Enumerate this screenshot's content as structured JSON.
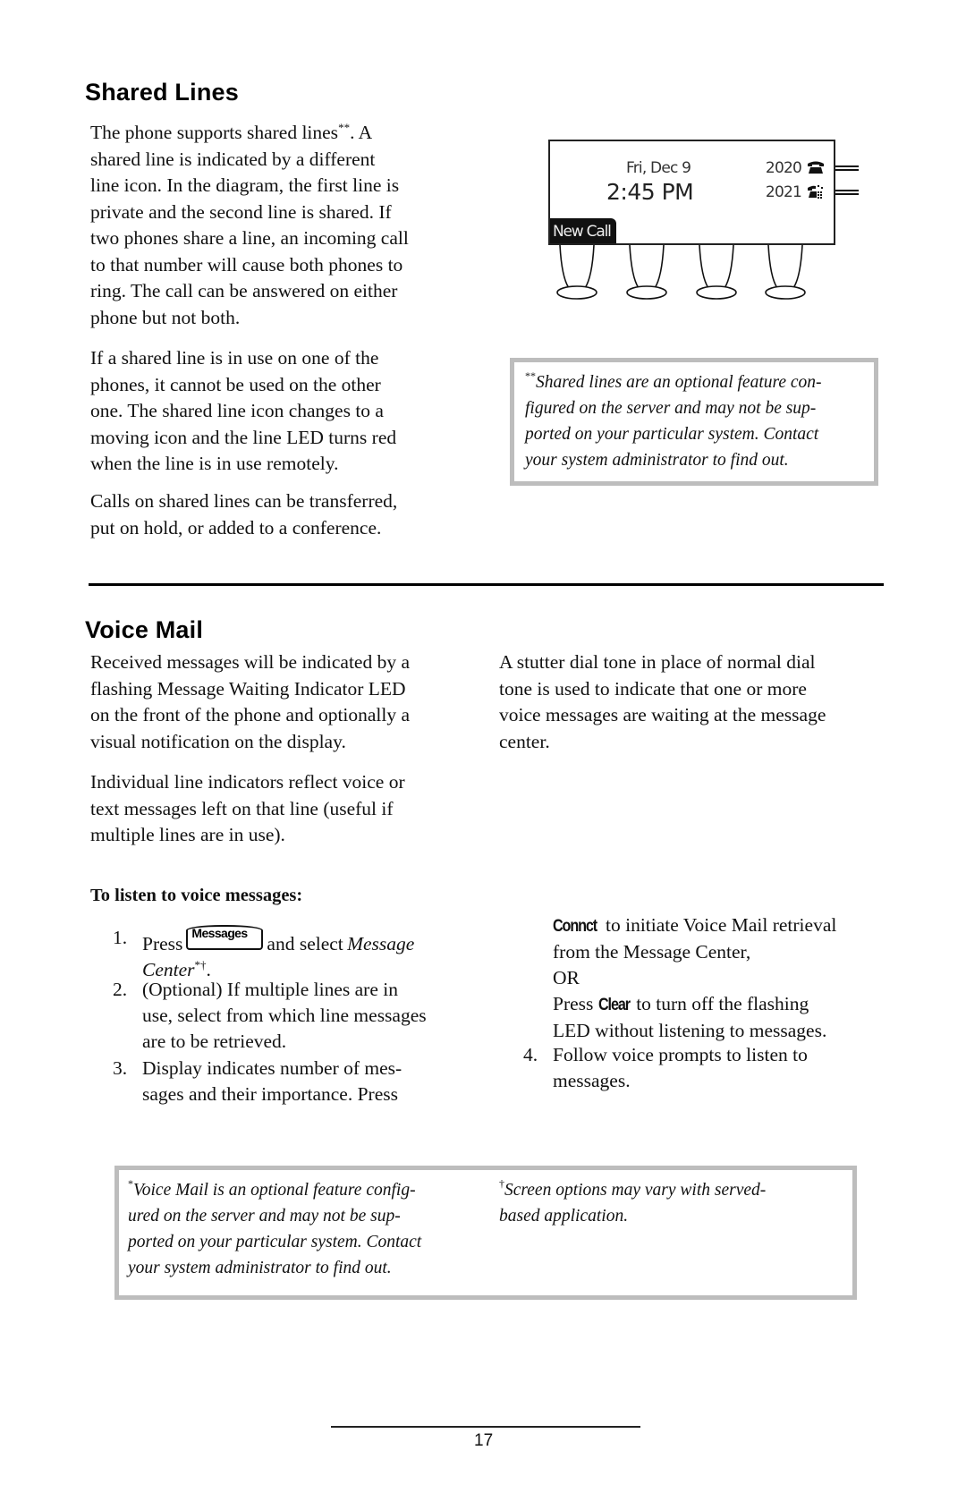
{
  "shared_lines": {
    "heading": "Shared Lines",
    "para1_lines": [
      "The phone supports shared lines",
      ".  A",
      "shared line is indicated by a different",
      "line icon.  In the diagram, the first line is",
      "private and the second line is shared.  If",
      "two phones share a line, an incoming call",
      "to that number will cause both phones to",
      "ring.  The call can be answered on either",
      "phone but not both."
    ],
    "para1_marker": "**",
    "para2_lines": [
      "If a shared line is in use on one of the",
      "phones, it cannot be used on the other",
      "one.  The shared line icon changes to a",
      "moving icon and the line LED turns red",
      "when the line is in use remotely."
    ],
    "para3_lines": [
      "Calls on shared lines can be transferred,",
      "put on hold, or added to a conference."
    ],
    "display": {
      "date": "Fri, Dec 9",
      "time": "2:45 PM",
      "lines": [
        {
          "number": "2020",
          "icon": "private-line-phone-icon"
        },
        {
          "number": "2021",
          "icon": "shared-line-phone-icon"
        }
      ],
      "softkey": "New Call"
    },
    "footnote": {
      "marker": "**",
      "lines": [
        "Shared lines are an optional feature con-",
        "figured on the server and may not be sup-",
        "ported on your particular system.  Contact",
        "your system administrator to find out."
      ]
    }
  },
  "voice_mail": {
    "heading": "Voice Mail",
    "col1_para1_lines": [
      "Received messages will be indicated by a",
      "flashing Message Waiting Indicator LED",
      "on the front of the phone and optionally a",
      "visual notification on the display."
    ],
    "col1_para2_lines": [
      "Individual line indicators reflect voice or",
      "text messages left on that line (useful if",
      "multiple lines are in use)."
    ],
    "col2_para1_lines": [
      "A stutter dial tone in place of normal dial",
      "tone is used to indicate that one or more",
      "voice messages are waiting at the message",
      "center."
    ],
    "procedure_heading": "To listen to voice messages:",
    "steps": [
      {
        "number": "1.",
        "pre": "Press",
        "key": "Messages",
        "mid": "and select",
        "italic": "Message",
        "line2_italic": "Center",
        "line2_marker": "*†",
        "line2_end": "."
      },
      {
        "number": "2.",
        "lines": [
          "(Optional)  If multiple lines are in",
          "use, select from which line messages",
          "are to be retrieved."
        ]
      },
      {
        "number": "3.",
        "lines": [
          "Display indicates number of mes-",
          "sages and their importance.  Press"
        ],
        "continuation": {
          "softkey1": "Connct",
          "line1_rest": "to initiate Voice Mail retrieval",
          "line2": "from the Message Center,",
          "line3": "OR",
          "line4_pre": "Press",
          "softkey2": "Clear",
          "line4_rest": "to turn off the flashing",
          "line5": "LED without listening to messages."
        }
      },
      {
        "number": "4.",
        "lines": [
          "Follow voice prompts to listen to",
          "messages."
        ]
      }
    ],
    "footnotes": [
      {
        "marker": "*",
        "lines": [
          "Voice Mail is an optional feature config-",
          "ured on the server and may not be sup-",
          "ported on your particular system.  Contact",
          "your system administrator to find out."
        ]
      },
      {
        "marker": "†",
        "lines": [
          "Screen options may vary with served-",
          "based application."
        ]
      }
    ]
  },
  "footer": {
    "page_number": "17"
  }
}
